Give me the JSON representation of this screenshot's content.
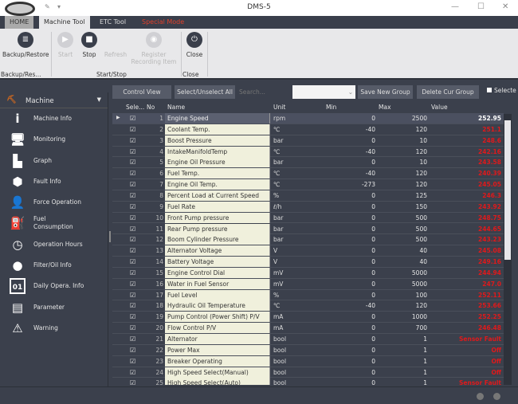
{
  "window": {
    "title": "DMS-5"
  },
  "tabs": [
    {
      "label": "HOME"
    },
    {
      "label": "Machine Tool"
    },
    {
      "label": "ETC Tool"
    },
    {
      "label": "Special Mode"
    }
  ],
  "ribbon": {
    "buttons": [
      {
        "label": "Backup/Restore",
        "icon": "database-restore-icon"
      },
      {
        "label": "Start",
        "icon": "play-icon"
      },
      {
        "label": "Stop",
        "icon": "stop-icon"
      },
      {
        "label": "Refresh",
        "icon": "refresh-icon"
      },
      {
        "label": "Register Recording Item",
        "icon": "record-icon"
      },
      {
        "label": "Close",
        "icon": "power-icon"
      }
    ],
    "groups": [
      "Backup/Res...",
      "Start/Stop",
      "Close"
    ]
  },
  "sidebar": {
    "header": "Machine",
    "items": [
      {
        "label": "Machine Info",
        "icon": "info-icon"
      },
      {
        "label": "Monitoring",
        "icon": "monitor-icon"
      },
      {
        "label": "Graph",
        "icon": "bar-chart-icon"
      },
      {
        "label": "Fault Info",
        "icon": "broken-shield-icon"
      },
      {
        "label": "Force Operation",
        "icon": "user-arrow-icon"
      },
      {
        "label": "Fuel Consumption",
        "icon": "fuel-pump-icon"
      },
      {
        "label": "Operation Hours",
        "icon": "clock-icon"
      },
      {
        "label": "Filter/Oil Info",
        "icon": "oil-drop-icon"
      },
      {
        "label": "Daily Opera. Info",
        "icon": "calendar-icon"
      },
      {
        "label": "Parameter",
        "icon": "clipboard-icon"
      },
      {
        "label": "Warning",
        "icon": "warning-icon"
      }
    ]
  },
  "toolbar": {
    "control_view": "Control View",
    "select_all": "Select/Unselect All",
    "search_placeholder": "Search...",
    "save_group": "Save New Group",
    "delete_group": "Delete Cur Group",
    "selected_label": "Selecte"
  },
  "grid": {
    "columns": [
      "Sele...",
      "No",
      "Name",
      "Unit",
      "Min",
      "Max",
      "Value"
    ],
    "rows": [
      {
        "no": "1",
        "name": "Engine Speed",
        "unit": "rpm",
        "min": "0",
        "max": "2500",
        "value": "252.95"
      },
      {
        "no": "2",
        "name": "Coolant Temp.",
        "unit": "℃",
        "min": "-40",
        "max": "120",
        "value": "251.1"
      },
      {
        "no": "3",
        "name": "Boost Pressure",
        "unit": "bar",
        "min": "0",
        "max": "10",
        "value": "248.6"
      },
      {
        "no": "4",
        "name": "IntakeManifoldTemp",
        "unit": "℃",
        "min": "-40",
        "max": "120",
        "value": "242.16"
      },
      {
        "no": "5",
        "name": "Engine Oil Pressure",
        "unit": "bar",
        "min": "0",
        "max": "10",
        "value": "243.58"
      },
      {
        "no": "6",
        "name": "Fuel Temp.",
        "unit": "℃",
        "min": "-40",
        "max": "120",
        "value": "240.39"
      },
      {
        "no": "7",
        "name": "Engine Oil Temp.",
        "unit": "℃",
        "min": "-273",
        "max": "120",
        "value": "245.05"
      },
      {
        "no": "8",
        "name": "Percent Load at Current Speed",
        "unit": "%",
        "min": "0",
        "max": "125",
        "value": "246.3"
      },
      {
        "no": "9",
        "name": "Fuel Rate",
        "unit": "ℓ/h",
        "min": "0",
        "max": "150",
        "value": "243.92"
      },
      {
        "no": "10",
        "name": "Front Pump pressure",
        "unit": "bar",
        "min": "0",
        "max": "500",
        "value": "248.75"
      },
      {
        "no": "11",
        "name": "Rear Pump pressure",
        "unit": "bar",
        "min": "0",
        "max": "500",
        "value": "244.65"
      },
      {
        "no": "12",
        "name": "Boom Cylinder Pressure",
        "unit": "bar",
        "min": "0",
        "max": "500",
        "value": "243.23"
      },
      {
        "no": "13",
        "name": "Alternator Voltage",
        "unit": "V",
        "min": "0",
        "max": "40",
        "value": "245.08"
      },
      {
        "no": "14",
        "name": "Battery Voltage",
        "unit": "V",
        "min": "0",
        "max": "40",
        "value": "249.16"
      },
      {
        "no": "15",
        "name": "Engine Control Dial",
        "unit": "mV",
        "min": "0",
        "max": "5000",
        "value": "244.94"
      },
      {
        "no": "16",
        "name": "Water in Fuel Sensor",
        "unit": "mV",
        "min": "0",
        "max": "5000",
        "value": "247.0"
      },
      {
        "no": "17",
        "name": "Fuel Level",
        "unit": "%",
        "min": "0",
        "max": "100",
        "value": "252.11"
      },
      {
        "no": "18",
        "name": "Hydraulic Oil Temperature",
        "unit": "℃",
        "min": "-40",
        "max": "120",
        "value": "253.66"
      },
      {
        "no": "19",
        "name": "Pump Control (Power Shift) P/V",
        "unit": "mA",
        "min": "0",
        "max": "1000",
        "value": "252.25"
      },
      {
        "no": "20",
        "name": "Flow Control P/V",
        "unit": "mA",
        "min": "0",
        "max": "700",
        "value": "246.48"
      },
      {
        "no": "21",
        "name": "Alternator",
        "unit": "bool",
        "min": "0",
        "max": "1",
        "value": "Sensor Fault"
      },
      {
        "no": "22",
        "name": "Power Max",
        "unit": "bool",
        "min": "0",
        "max": "1",
        "value": "Off"
      },
      {
        "no": "23",
        "name": "Breaker Operating",
        "unit": "bool",
        "min": "0",
        "max": "1",
        "value": "Off"
      },
      {
        "no": "24",
        "name": "High Speed Select(Manual)",
        "unit": "bool",
        "min": "0",
        "max": "1",
        "value": "Off"
      },
      {
        "no": "25",
        "name": "High Speed Select(Auto)",
        "unit": "bool",
        "min": "0",
        "max": "1",
        "value": "Sensor Fault"
      }
    ]
  },
  "colors": {
    "accent_red": "#e0191b",
    "special_mode": "#e0402a",
    "background": "#3b404c"
  }
}
